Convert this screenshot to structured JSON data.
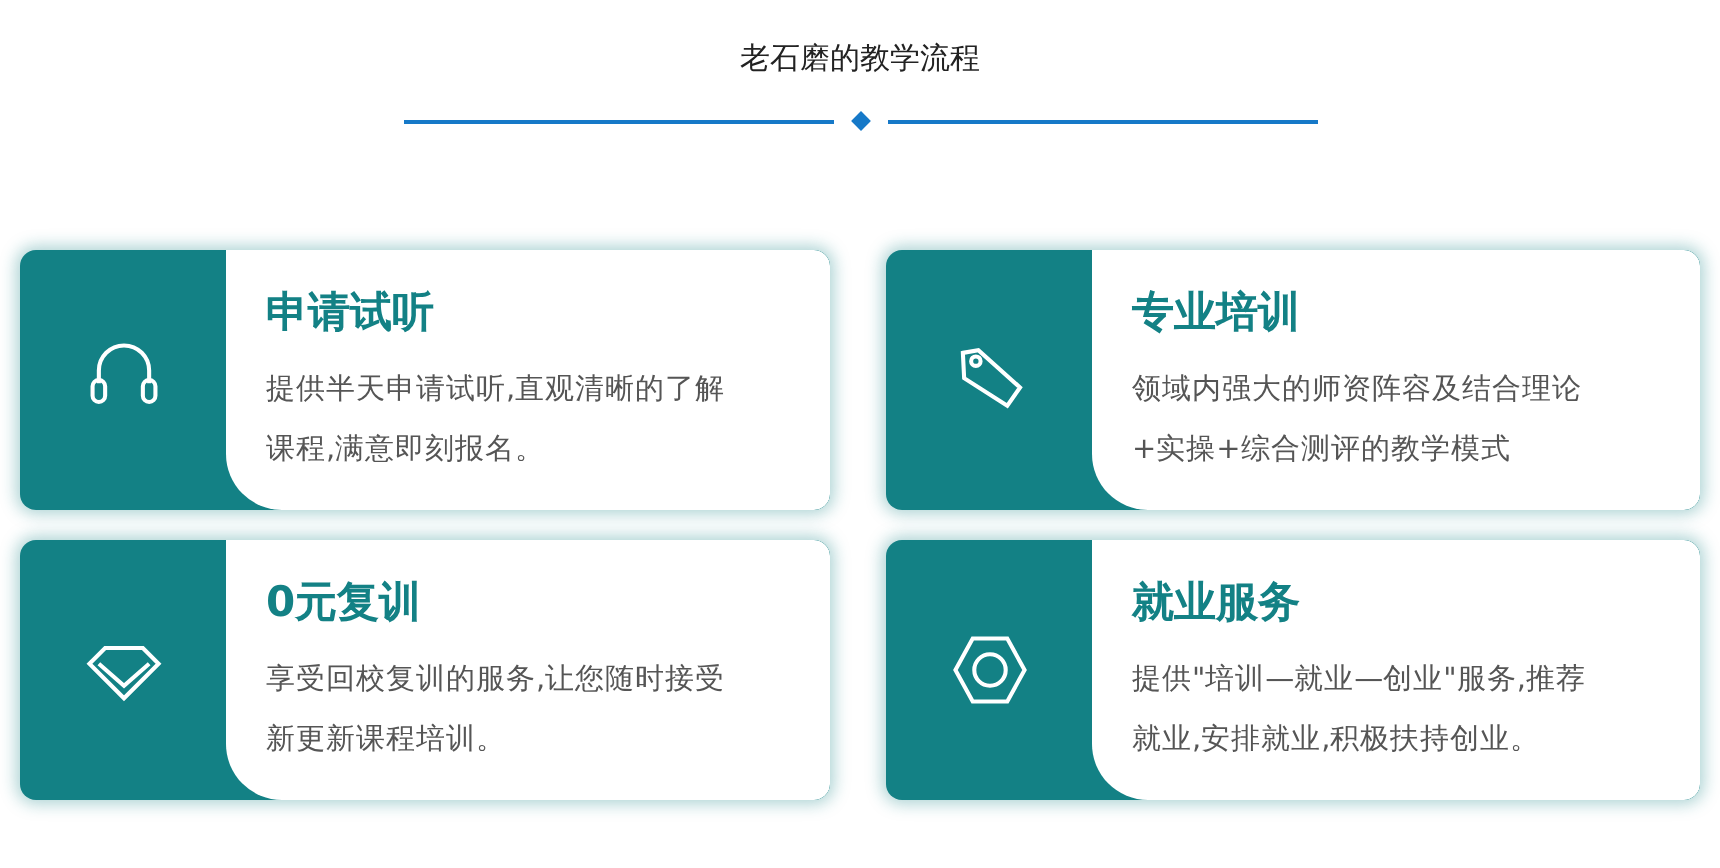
{
  "heading": "老石磨的教学流程",
  "cards": [
    {
      "title": "申请试听",
      "description": "提供半天申请试听,直观清晰的了解课程,满意即刻报名。"
    },
    {
      "title": "专业培训",
      "description": "领域内强大的师资阵容及结合理论+实操+综合测评的教学模式"
    },
    {
      "title": "0元复训",
      "description": "享受回校复训的服务,让您随时接受新更新课程培训。"
    },
    {
      "title": "就业服务",
      "description": "提供\"培训—就业—创业\"服务,推荐就业,安排就业,积极扶持创业。"
    }
  ]
}
